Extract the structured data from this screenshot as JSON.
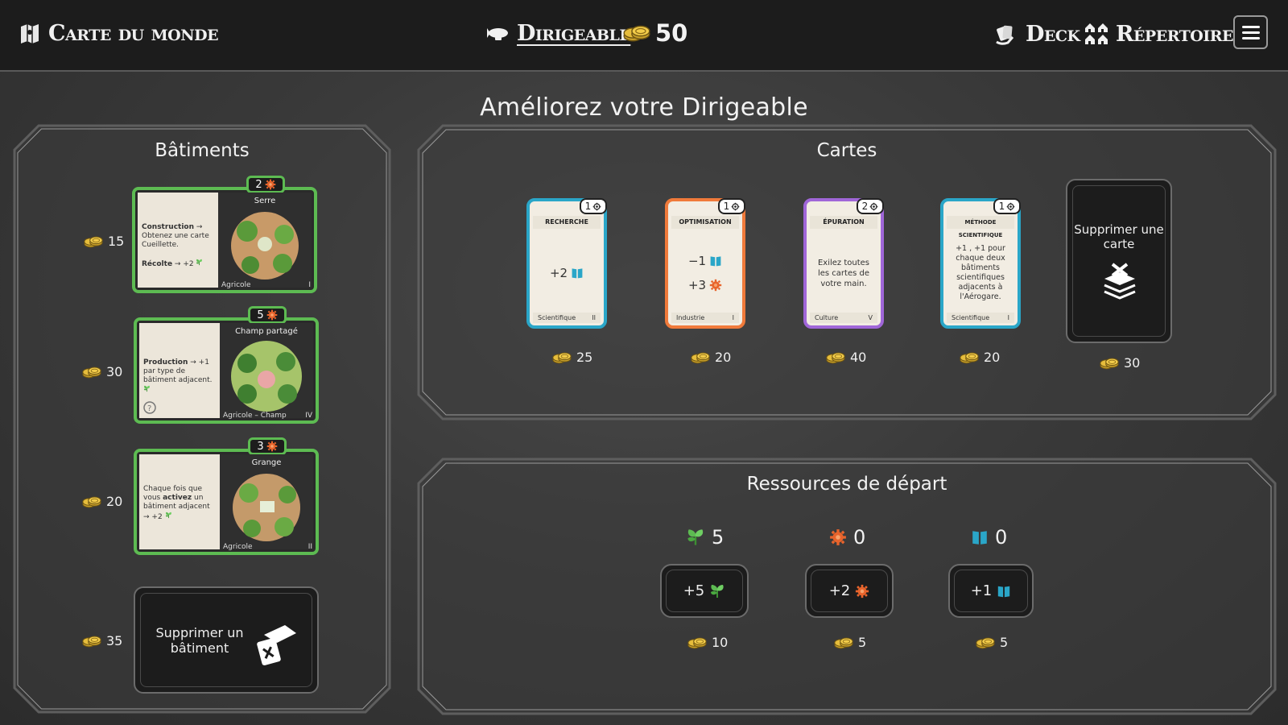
{
  "topbar": {
    "world_map": {
      "label": "Carte du monde",
      "icon": "map-icon"
    },
    "airship": {
      "label": "Dirigeable",
      "icon": "airship-icon"
    },
    "coins": {
      "value": "50",
      "icon": "coins-icon"
    },
    "deck": {
      "label": "Deck",
      "icon": "cards-hand-icon"
    },
    "directory": {
      "label": "Répertoire",
      "icon": "buildings-icon"
    },
    "menu": {
      "icon": "hamburger-menu-icon"
    }
  },
  "page_title": "Améliorez votre Dirigeable",
  "buildings_panel": {
    "title": "Bâtiments",
    "items": [
      {
        "price": "15",
        "name": "Serre",
        "cost": "2",
        "category": "Agricole",
        "tier": "I",
        "line1_label": "Construction",
        "line1_text": "→ Obtenez une carte Cueillette.",
        "line2_label": "Récolte",
        "line2_text": "→ +2"
      },
      {
        "price": "30",
        "name": "Champ partagé",
        "cost": "5",
        "category": "Agricole – Champ",
        "tier": "IV",
        "line1_label": "Production",
        "line1_text": "→ +1 par type de bâtiment adjacent."
      },
      {
        "price": "20",
        "name": "Grange",
        "cost": "3",
        "category": "Agricole",
        "tier": "II",
        "line1_text": "Chaque fois que vous",
        "line1_label": "activez",
        "line2_text": "un bâtiment adjacent → +2"
      }
    ],
    "delete": {
      "label": "Supprimer un bâtiment",
      "price": "35",
      "icon": "delete-building-icon"
    }
  },
  "cards_panel": {
    "title": "Cartes",
    "items": [
      {
        "name": "RECHERCHE",
        "cost": "1",
        "type": "Scientifique",
        "tier": "II",
        "effect": "+2",
        "price": "25",
        "color": "#2aa6c8"
      },
      {
        "name": "OPTIMISATION",
        "cost": "1",
        "type": "Industrie",
        "tier": "I",
        "effect1": "−1",
        "effect2": "+3",
        "price": "20",
        "color": "#f07a3a"
      },
      {
        "name": "ÉPURATION",
        "cost": "2",
        "type": "Culture",
        "tier": "V",
        "effect": "Exilez toutes les cartes de votre main.",
        "price": "40",
        "color": "#a066d8"
      },
      {
        "name": "MÉTHODE SCIENTIFIQUE",
        "cost": "1",
        "type": "Scientifique",
        "tier": "I",
        "effect": "+1 , +1 pour chaque deux bâtiments scientifiques adjacents à l'Aérogare.",
        "price": "20",
        "color": "#2aa6c8"
      }
    ],
    "delete": {
      "label": "Supprimer une carte",
      "price": "30",
      "icon": "delete-card-icon"
    }
  },
  "resources_panel": {
    "title": "Ressources de départ",
    "items": [
      {
        "value": "5",
        "icon": "leaf-icon",
        "button": "+5",
        "price": "10",
        "color": "#5dbb52"
      },
      {
        "value": "0",
        "icon": "gear-cog-icon",
        "button": "+2",
        "price": "5",
        "color": "#f07a3a"
      },
      {
        "value": "0",
        "icon": "book-icon",
        "button": "+1",
        "price": "5",
        "color": "#2aa6c8"
      }
    ]
  }
}
